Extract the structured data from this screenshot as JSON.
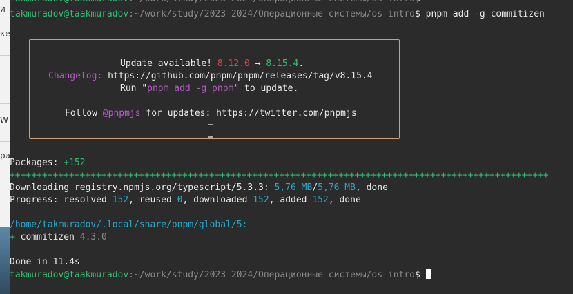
{
  "left_panel": {
    "fragments": [
      "и",
      "ке",
      "W",
      "ра"
    ]
  },
  "terminal": {
    "prompt_user": "takmuradov@taakmuradov",
    "prompt_path": ":~/work/study/2023-2024/Операционные системы/os-intro",
    "prompt_symbol": "$",
    "command": " pnpm add -g commitizen",
    "update_box": {
      "line1_prefix": "Update available! ",
      "old_version": "8.12.0",
      "arrow": " → ",
      "new_version": "8.15.4",
      "line1_suffix": ".",
      "changelog_label": "Changelog:",
      "changelog_url": " https://github.com/pnpm/pnpm/releases/tag/v8.15.4",
      "run_prefix": "Run \"",
      "run_command": "pnpm add -g pnpm",
      "run_suffix": "\" to update.",
      "follow_prefix": "Follow ",
      "follow_handle": "@pnpmjs",
      "follow_suffix": " for updates: https://twitter.com/pnpmjs"
    },
    "packages_label": "Packages: ",
    "packages_count": "+152",
    "progress_bar": "++++++++++++++++++++++++++++++++++++++++++++++++++++++++++++++++++++++++++++++++++++++++++++++++++++",
    "downloading_label": "Downloading registry.npmjs.org/typescript/5.3.3: ",
    "downloaded_size": "5,76 MB",
    "size_sep": "/",
    "total_size": "5,76 MB",
    "downloading_done": ", done",
    "progress_line": {
      "p1": "Progress: resolved ",
      "resolved": "152",
      "p2": ", reused ",
      "reused": "0",
      "p3": ", downloaded ",
      "downloaded": "152",
      "p4": ", added ",
      "added": "152",
      "p5": ", done"
    },
    "global_path": "/home/takmuradov/.local/share/pnpm/global/5:",
    "plus_sign": "+",
    "pkg_name": " commitizen ",
    "pkg_version": "4.3.0",
    "done_text": "Done in 11.4s"
  },
  "colors": {
    "background": "#2b2b2b",
    "text": "#e6e6e6",
    "prompt_green": "#2fbf71",
    "red": "#e0454b",
    "magenta": "#b35bc2",
    "cyan": "#28a6c9",
    "box_border": "#d0a070"
  }
}
